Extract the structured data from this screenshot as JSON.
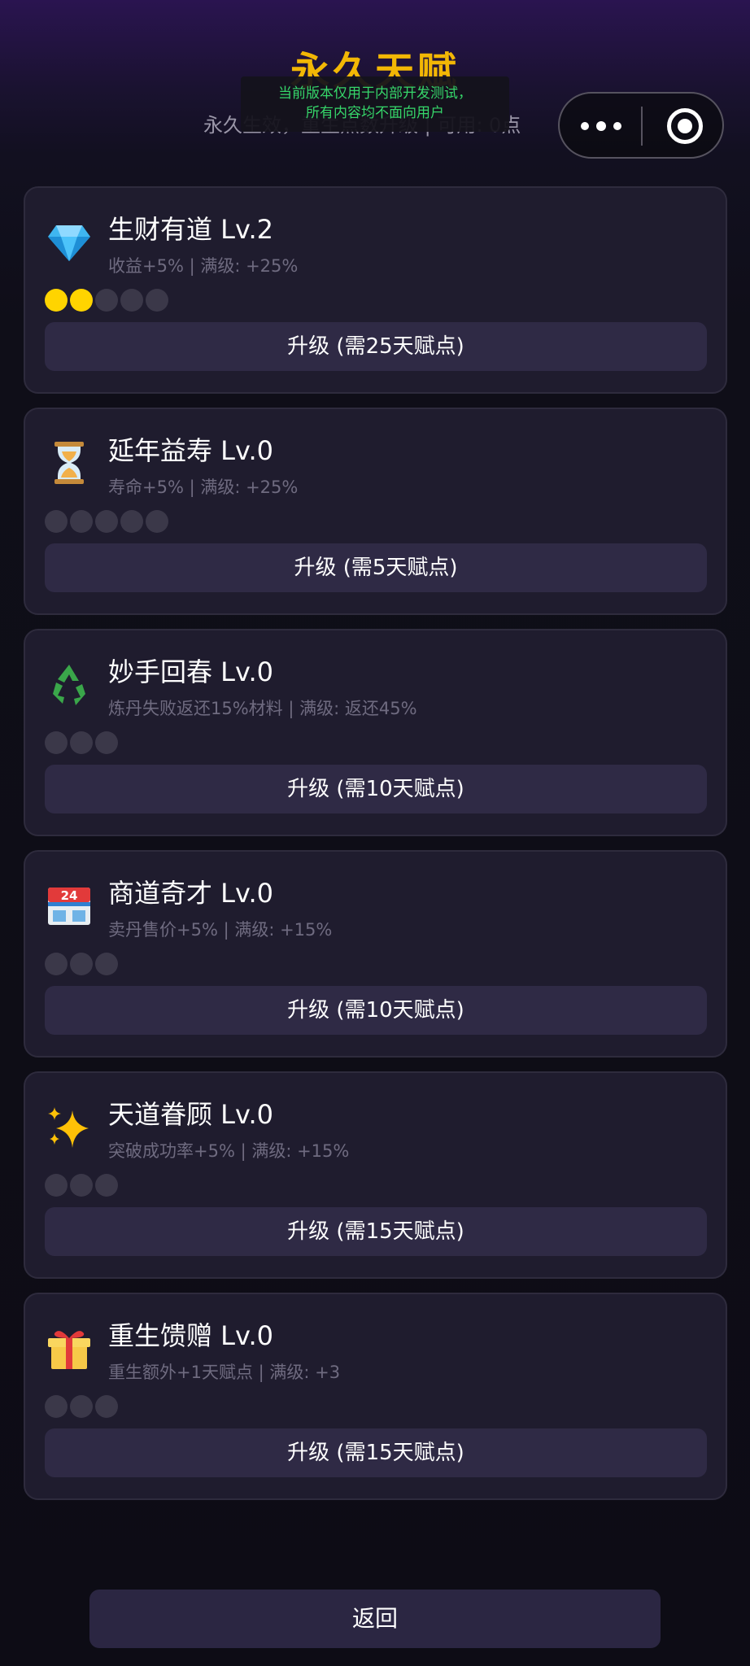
{
  "header": {
    "title": "永久天赋",
    "subtitle": "永久生效，重生点数升级 | 可用: 0点"
  },
  "dev_banner": {
    "line1": "当前版本仅用于内部开发测试，",
    "line2": "所有内容均不面向用户"
  },
  "capsule": {
    "more_icon": "more-dots-icon",
    "close_icon": "target-close-icon"
  },
  "talents": [
    {
      "icon": "gem-icon",
      "name": "生财有道 Lv.2",
      "desc": "收益+5% | 满级: +25%",
      "level": 2,
      "max_level": 5,
      "button": "升级 (需25天赋点)"
    },
    {
      "icon": "hourglass-icon",
      "name": "延年益寿 Lv.0",
      "desc": "寿命+5% | 满级: +25%",
      "level": 0,
      "max_level": 5,
      "button": "升级 (需5天赋点)"
    },
    {
      "icon": "recycle-icon",
      "name": "妙手回春 Lv.0",
      "desc": "炼丹失败返还15%材料 | 满级: 返还45%",
      "level": 0,
      "max_level": 3,
      "button": "升级 (需10天赋点)"
    },
    {
      "icon": "store-24-icon",
      "name": "商道奇才 Lv.0",
      "desc": "卖丹售价+5% | 满级: +15%",
      "level": 0,
      "max_level": 3,
      "button": "升级 (需10天赋点)"
    },
    {
      "icon": "sparkles-icon",
      "name": "天道眷顾 Lv.0",
      "desc": "突破成功率+5% | 满级: +15%",
      "level": 0,
      "max_level": 3,
      "button": "升级 (需15天赋点)"
    },
    {
      "icon": "gift-icon",
      "name": "重生馈赠 Lv.0",
      "desc": "重生额外+1天赋点 | 满级: +3",
      "level": 0,
      "max_level": 3,
      "button": "升级 (需15天赋点)"
    }
  ],
  "footer": {
    "back_label": "返回"
  },
  "colors": {
    "title": "#f2b705",
    "dot_on": "#ffd400",
    "dot_off": "#3b3849",
    "banner_text": "#36d66a"
  }
}
